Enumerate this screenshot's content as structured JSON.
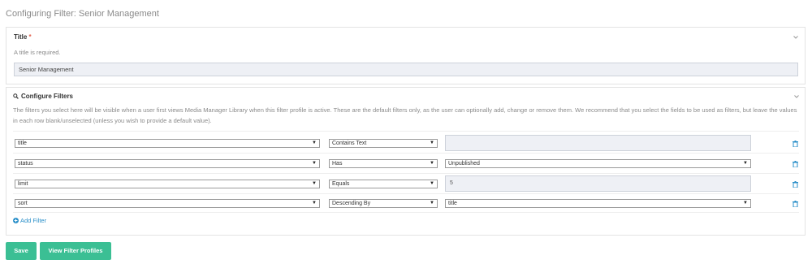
{
  "page": {
    "title": "Configuring Filter: Senior Management"
  },
  "title_section": {
    "label": "Title",
    "required_mark": "*",
    "help": "A title is required.",
    "value": "Senior Management"
  },
  "filters_section": {
    "label": "Configure Filters",
    "help": "The filters you select here will be visible when a user first views Media Manager Library when this filter profile is active. These are the default filters only, as the user can optionally add, change or remove them. We recommend that you select the fields to be used as filters, but leave the values in each row blank/unselected (unless you wish to provide a default value).",
    "rows": [
      {
        "field": "title",
        "operator": "Contains Text",
        "value": ""
      },
      {
        "field": "status",
        "operator": "Has",
        "value": "Unpublished"
      },
      {
        "field": "limit",
        "operator": "Equals",
        "value": "5"
      },
      {
        "field": "sort",
        "operator": "Descending By",
        "value": "title"
      }
    ],
    "add_filter_label": "Add Filter"
  },
  "actions": {
    "save_label": "Save",
    "view_profiles_label": "View Filter Profiles"
  },
  "colors": {
    "accent_button": "#3bbf94",
    "link": "#2a8fc9",
    "required": "#e2604d"
  },
  "icons": [
    "chevron-down-icon",
    "search-icon",
    "trash-icon",
    "plus-circle-icon"
  ]
}
